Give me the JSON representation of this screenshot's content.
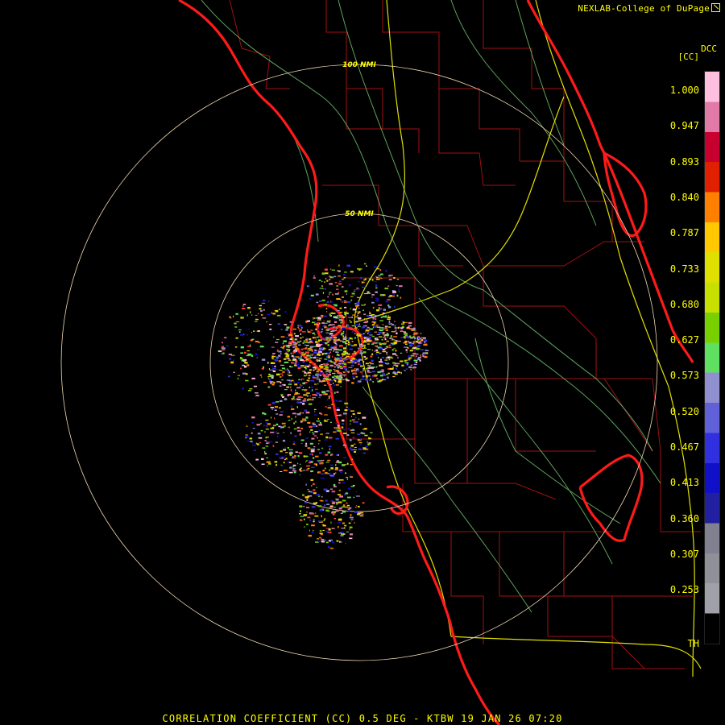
{
  "header": {
    "credit": "NEXLAB-College of DuPage"
  },
  "legend": {
    "product": "DCC",
    "unit": "[CC]",
    "labels": [
      "1.000",
      "0.947",
      "0.893",
      "0.840",
      "0.787",
      "0.733",
      "0.680",
      "0.627",
      "0.573",
      "0.520",
      "0.467",
      "0.413",
      "0.360",
      "0.307",
      "0.253",
      "TH"
    ],
    "colors": [
      "#ffc0e0",
      "#e27aa8",
      "#c80030",
      "#e02000",
      "#ff8000",
      "#ffc800",
      "#e0e000",
      "#c8e000",
      "#78d000",
      "#60e060",
      "#9090d0",
      "#6060d8",
      "#3030e0",
      "#1010c8",
      "#2020a0",
      "#808090",
      "#909098",
      "#a0a0a8",
      "#000000"
    ]
  },
  "range_rings": [
    {
      "label": "100 NMI"
    },
    {
      "label": "50 NMI"
    }
  ],
  "footer": {
    "title": "CORRELATION COEFFICIENT (CC) 0.5 DEG - KTBW 19 JAN 26 07:20"
  }
}
